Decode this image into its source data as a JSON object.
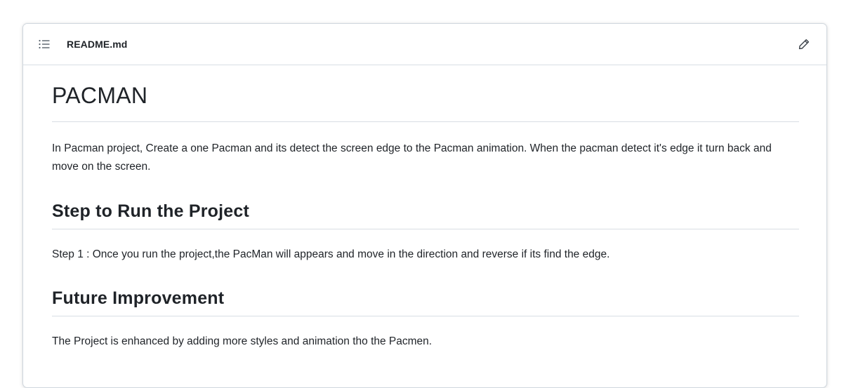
{
  "header": {
    "filename": "README.md",
    "toc_icon": "list-unordered-icon",
    "edit_icon": "pencil-icon"
  },
  "readme": {
    "title": "PACMAN",
    "intro": "In Pacman project, Create a one Pacman and its detect the screen edge to the Pacman animation. When the pacman detect it's edge it turn back and move on the screen.",
    "sections": [
      {
        "heading": "Step to Run the Project",
        "text": "Step 1 : Once you run the project,the PacMan will appears and move in the direction and reverse if its find the edge."
      },
      {
        "heading": "Future Improvement",
        "text": "The Project is enhanced by adding more styles and animation tho the Pacmen."
      }
    ]
  },
  "colors": {
    "border": "#d0d7de",
    "rule": "#d8dee4",
    "text": "#1f2328",
    "icon": "#57606a"
  }
}
